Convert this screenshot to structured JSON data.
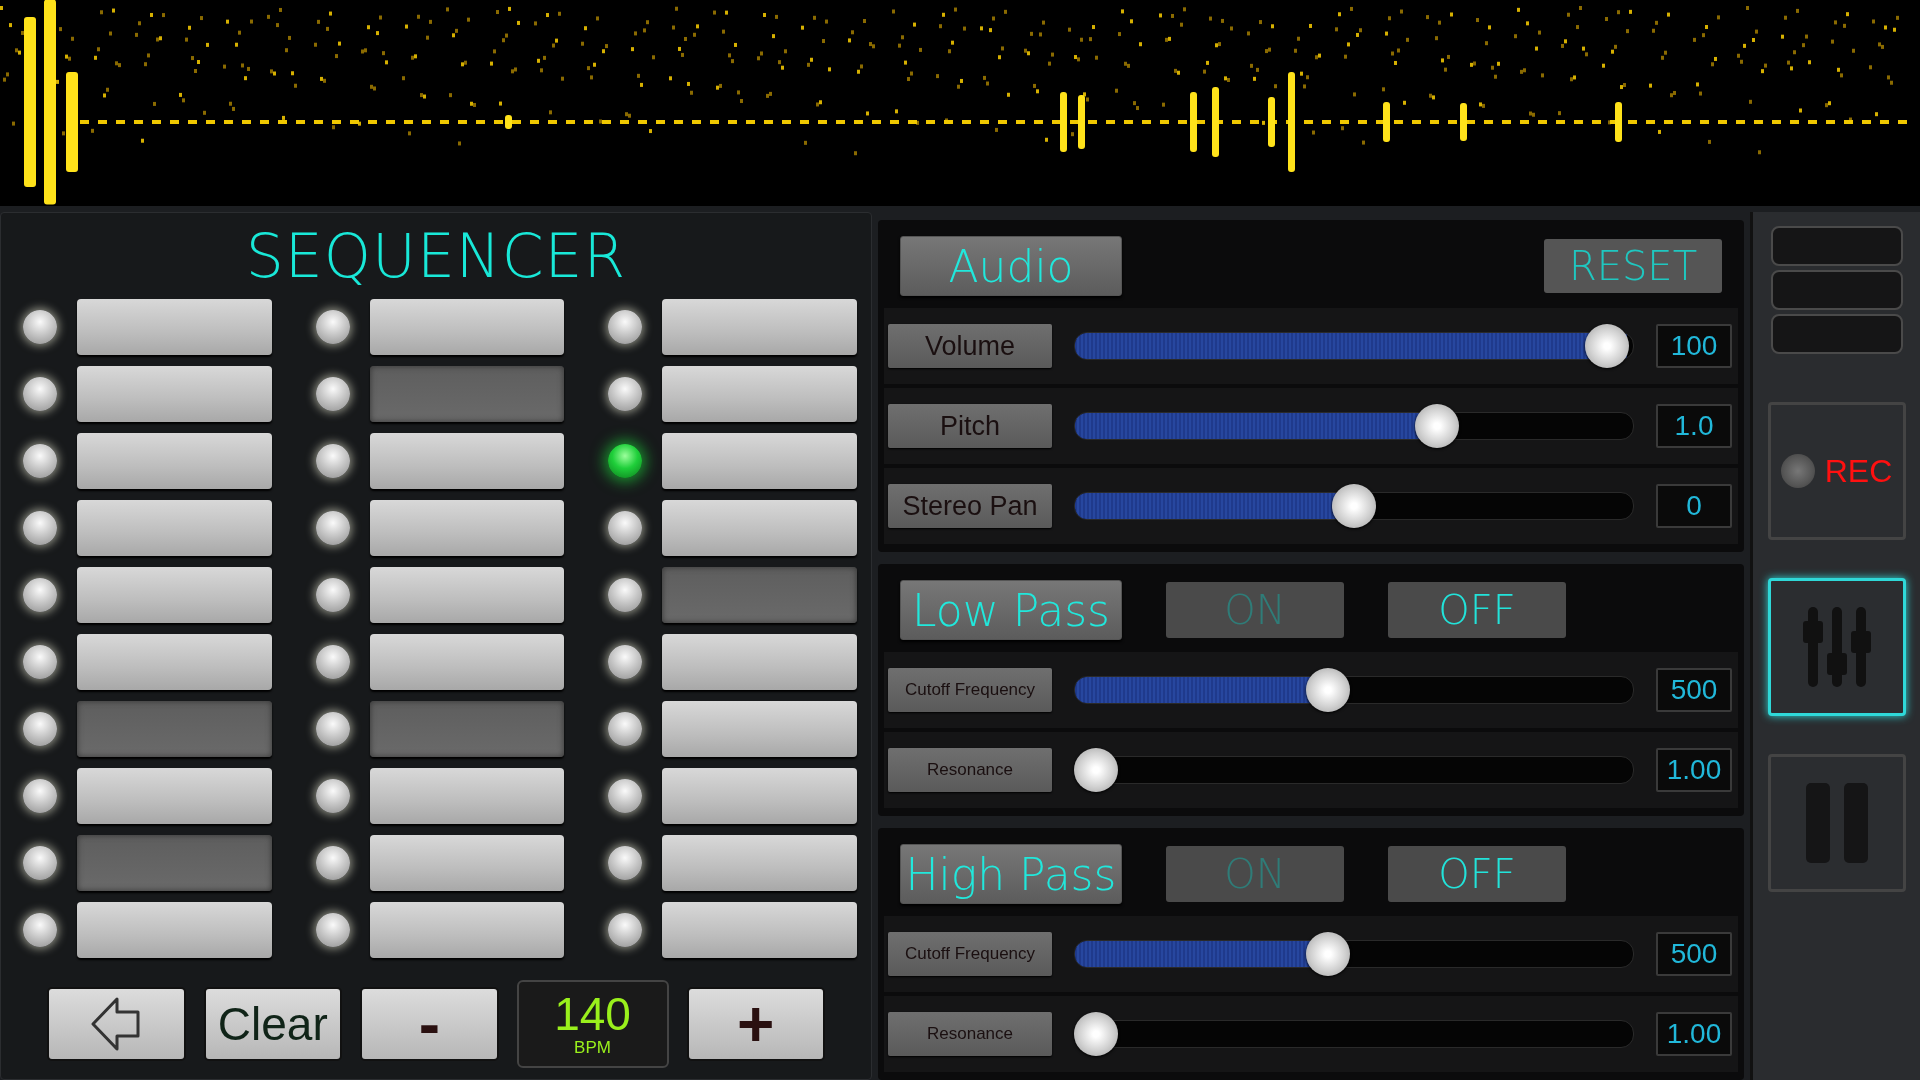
{
  "sequencer": {
    "title": "SEQUENCER",
    "columns": [
      [
        {
          "led_on": false,
          "pad_on": true
        },
        {
          "led_on": false,
          "pad_on": true
        },
        {
          "led_on": false,
          "pad_on": true
        },
        {
          "led_on": false,
          "pad_on": true
        },
        {
          "led_on": false,
          "pad_on": true
        },
        {
          "led_on": false,
          "pad_on": true
        },
        {
          "led_on": false,
          "pad_on": false
        },
        {
          "led_on": false,
          "pad_on": true
        },
        {
          "led_on": false,
          "pad_on": false
        },
        {
          "led_on": false,
          "pad_on": true
        }
      ],
      [
        {
          "led_on": false,
          "pad_on": true
        },
        {
          "led_on": false,
          "pad_on": false
        },
        {
          "led_on": false,
          "pad_on": true
        },
        {
          "led_on": false,
          "pad_on": true
        },
        {
          "led_on": false,
          "pad_on": true
        },
        {
          "led_on": false,
          "pad_on": true
        },
        {
          "led_on": false,
          "pad_on": false
        },
        {
          "led_on": false,
          "pad_on": true
        },
        {
          "led_on": false,
          "pad_on": true
        },
        {
          "led_on": false,
          "pad_on": true
        }
      ],
      [
        {
          "led_on": false,
          "pad_on": true
        },
        {
          "led_on": false,
          "pad_on": true
        },
        {
          "led_on": true,
          "pad_on": true
        },
        {
          "led_on": false,
          "pad_on": true
        },
        {
          "led_on": false,
          "pad_on": false
        },
        {
          "led_on": false,
          "pad_on": true
        },
        {
          "led_on": false,
          "pad_on": true
        },
        {
          "led_on": false,
          "pad_on": true
        },
        {
          "led_on": false,
          "pad_on": true
        },
        {
          "led_on": false,
          "pad_on": true
        }
      ]
    ],
    "clear_button": "Clear",
    "minus_button": "-",
    "plus_button": "+",
    "bpm": {
      "value": "140",
      "unit": "BPM"
    }
  },
  "sections": [
    {
      "kind": "audio",
      "title": "Audio",
      "reset_button": "RESET",
      "sliders": [
        {
          "label": "Volume",
          "level": 0.99,
          "value": "100"
        },
        {
          "label": "Pitch",
          "level": 0.66,
          "value": "1.0"
        },
        {
          "label": "Stereo Pan",
          "level": 0.5,
          "value": "0"
        }
      ]
    },
    {
      "kind": "filter",
      "title": "Low Pass",
      "toggles": [
        {
          "label": "ON",
          "selected": false
        },
        {
          "label": "OFF",
          "selected": true
        }
      ],
      "sliders": [
        {
          "label": "Cutoff Frequency",
          "level": 0.45,
          "value": "500"
        },
        {
          "label": "Resonance",
          "level": 0.0,
          "value": "1.00"
        }
      ]
    },
    {
      "kind": "filter",
      "title": "High Pass",
      "toggles": [
        {
          "label": "ON",
          "selected": false
        },
        {
          "label": "OFF",
          "selected": true
        }
      ],
      "sliders": [
        {
          "label": "Cutoff Frequency",
          "level": 0.45,
          "value": "500"
        },
        {
          "label": "Resonance",
          "level": 0.0,
          "value": "1.00"
        }
      ]
    }
  ],
  "side_panel": {
    "rec": {
      "label": "REC",
      "recording": false
    },
    "buttons": [
      {
        "kind": "mixer",
        "selected": true
      },
      {
        "kind": "pause",
        "selected": false
      }
    ]
  }
}
